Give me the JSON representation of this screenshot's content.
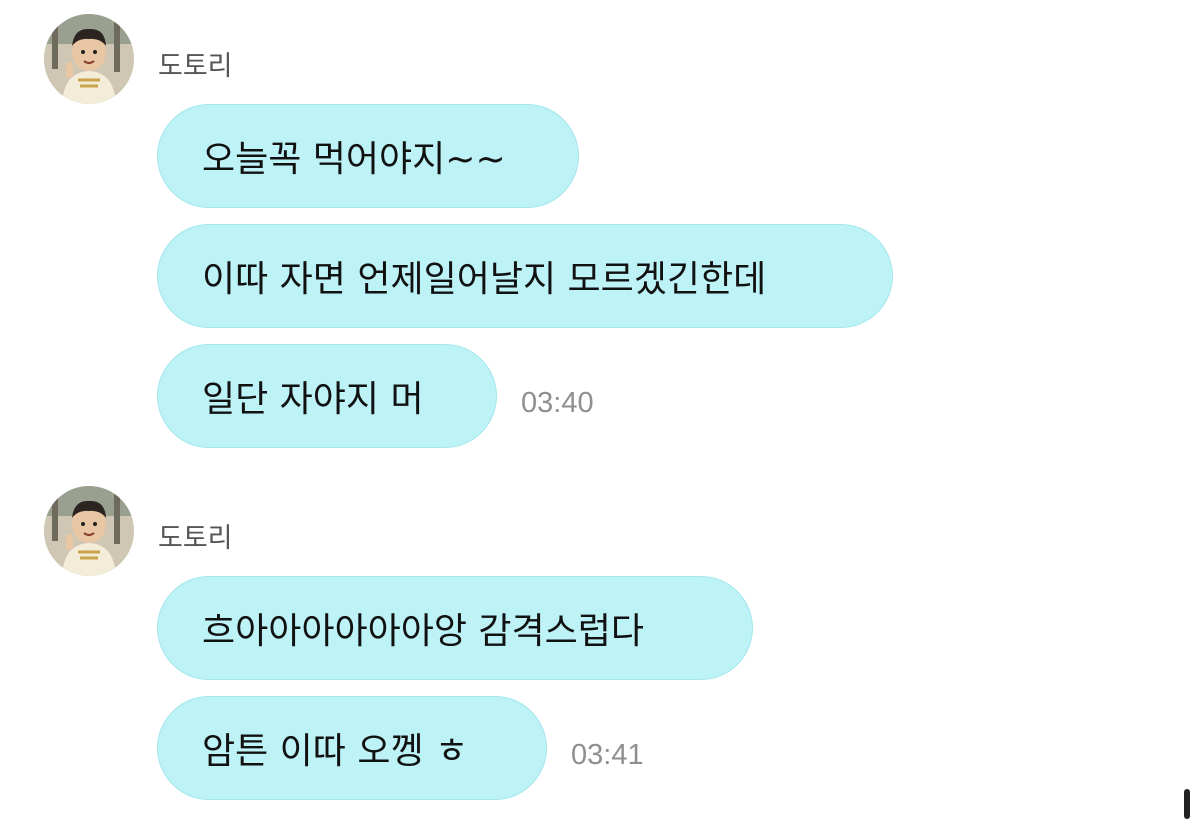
{
  "groups": [
    {
      "sender": "도토리",
      "messages": [
        {
          "text": "오늘꼭 먹어야지~~",
          "time": ""
        },
        {
          "text": "이따 자면 언제일어날지 모르겠긴한데",
          "time": ""
        },
        {
          "text": "일단 자야지 머",
          "time": "03:40"
        }
      ]
    },
    {
      "sender": "도토리",
      "messages": [
        {
          "text": "흐아아아아아아앙 감격스럽다",
          "time": ""
        },
        {
          "text": "암튼 이따 오껭 ㅎ",
          "time": "03:41"
        }
      ]
    }
  ],
  "colors": {
    "bubble": "#bdf2f6",
    "bubble_border": "#a6e6ee",
    "timestamp": "#8f8f8f",
    "sender": "#555555"
  },
  "icons": {
    "avatar": "profile-photo-avatar"
  }
}
